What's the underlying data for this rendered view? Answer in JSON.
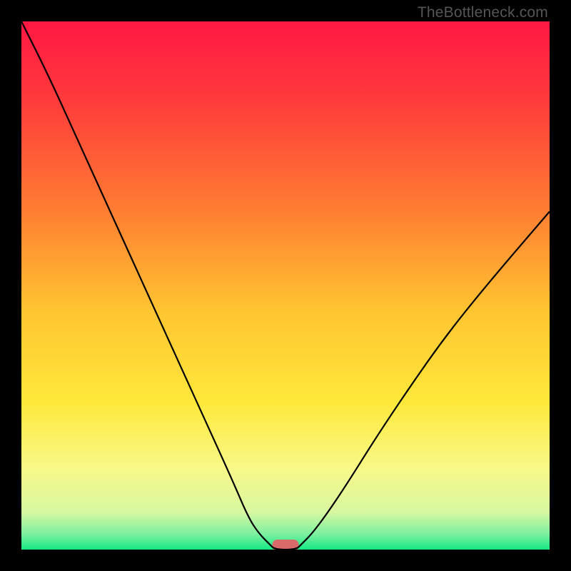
{
  "watermark": "TheBottleneck.com",
  "chart_data": {
    "type": "line",
    "title": "",
    "xlabel": "",
    "ylabel": "",
    "xlim": [
      0,
      100
    ],
    "ylim": [
      0,
      100
    ],
    "background_gradient": [
      {
        "stop": 0.0,
        "color": "#ff1744"
      },
      {
        "stop": 0.15,
        "color": "#ff3b3b"
      },
      {
        "stop": 0.35,
        "color": "#ff7a33"
      },
      {
        "stop": 0.55,
        "color": "#ffc531"
      },
      {
        "stop": 0.72,
        "color": "#ffe83a"
      },
      {
        "stop": 0.85,
        "color": "#f7f98a"
      },
      {
        "stop": 0.93,
        "color": "#d6f7a0"
      },
      {
        "stop": 0.97,
        "color": "#7ef0a0"
      },
      {
        "stop": 1.0,
        "color": "#17e884"
      }
    ],
    "series": [
      {
        "name": "bottleneck-curve",
        "x": [
          0,
          5,
          10,
          15,
          20,
          25,
          30,
          35,
          40,
          43,
          45,
          47,
          48,
          52,
          53,
          55,
          58,
          62,
          67,
          73,
          80,
          88,
          100
        ],
        "y": [
          100,
          90,
          79,
          68,
          57,
          46,
          35,
          24,
          13,
          6,
          3,
          1,
          0,
          0,
          1,
          3,
          7,
          13,
          21,
          30,
          40,
          50,
          64
        ]
      }
    ],
    "marker": {
      "name": "min-region",
      "x_center": 50,
      "width": 5,
      "color": "#d96a6a"
    }
  }
}
